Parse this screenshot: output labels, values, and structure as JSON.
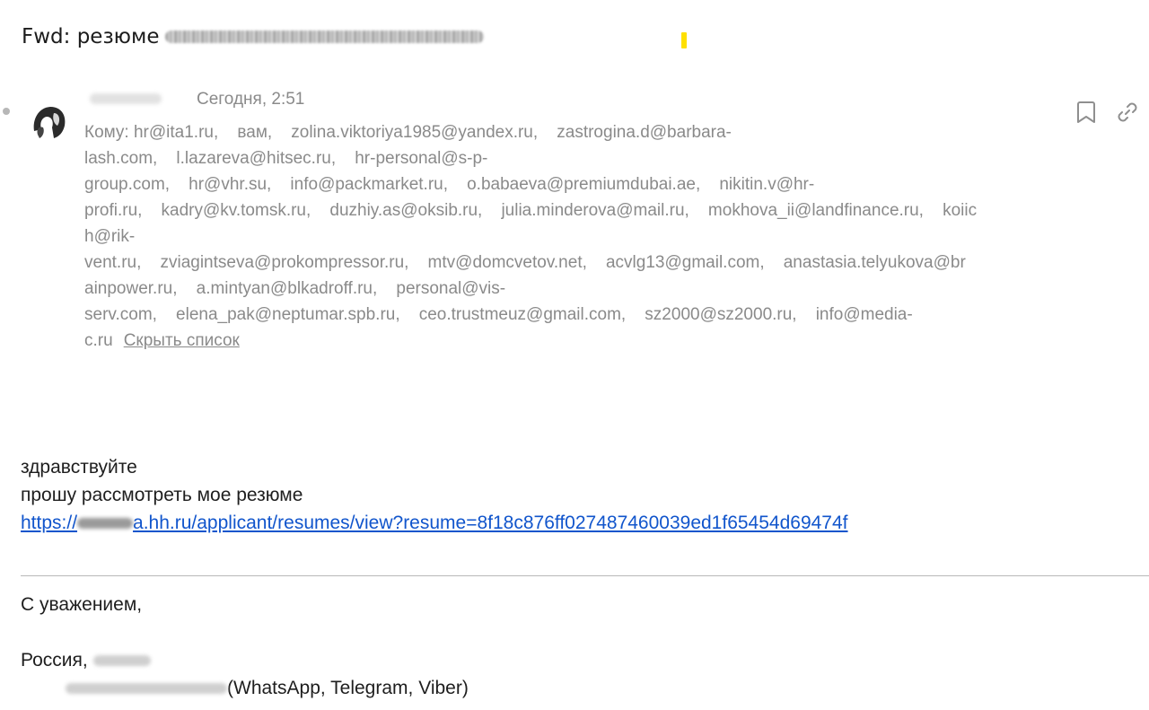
{
  "email": {
    "subject_prefix": "Fwd: резюме",
    "date": "Сегодня, 2:51",
    "to_label": "Кому:",
    "recipient_lines": [
      "hr@ita1.ru,    вам,    zolina.viktoriya1985@yandex.ru,    zastrogina.d@barbara-",
      "lash.com,    l.lazareva@hitsec.ru,    hr-personal@s-p-",
      "group.com,    hr@vhr.su,    info@packmarket.ru,    o.babaeva@premiumdubai.ae,    nikitin.v@hr-",
      "profi.ru,    kadry@kv.tomsk.ru,    duzhiy.as@oksib.ru,    julia.minderova@mail.ru,    mokhova_ii@landfinance.ru,    koiic",
      "h@rik-",
      "vent.ru,    zviagintseva@prokompressor.ru,    mtv@domcvetov.net,    acvlg13@gmail.com,    anastasia.telyukova@br",
      "ainpower.ru,    a.mintyan@blkadroff.ru,    personal@vis-",
      "serv.com,    elena_pak@neptumar.spb.ru,    ceo.trustmeuz@gmail.com,    sz2000@sz2000.ru,    info@media-",
      "c.ru"
    ],
    "hide_list_label": "Скрыть список",
    "icons": {
      "bookmark": "bookmark-icon",
      "link": "link-icon"
    }
  },
  "body": {
    "greeting": "здравствуйте",
    "request": "прошу рассмотреть мое резюме",
    "link_text_prefix": "https://",
    "link_text_suffix": "a.hh.ru/applicant/resumes/view?resume=8f18c876ff027487460039ed1f65454d69474f"
  },
  "signature": {
    "regards": "С уважением,",
    "country": "Россия,",
    "messengers": "(WhatsApp, Telegram, Viber)"
  },
  "colors": {
    "link": "#1155cc",
    "meta_text": "#8a8a8a",
    "highlight": "#ffe000"
  }
}
